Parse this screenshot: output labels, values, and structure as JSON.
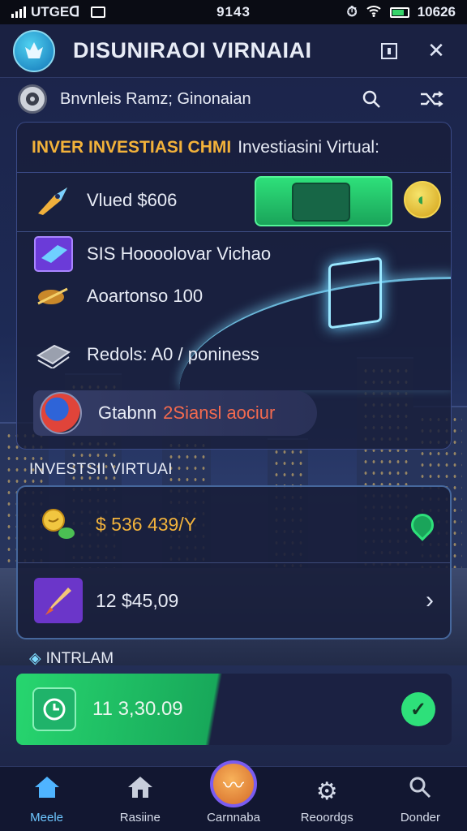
{
  "status_bar": {
    "carrier": "UTGEᗡ",
    "time": "9143",
    "right_text": "10626",
    "battery_level": 0.8
  },
  "header": {
    "title": "DISUNIRAOI VIRNAIAI",
    "icons": {
      "logo": "app-logo",
      "menu": "square-menu-icon",
      "close": "close-icon"
    }
  },
  "sub_header": {
    "label": "Bnvnleis Ramz; Ginonaian",
    "icons": [
      "settings-avatar",
      "search-refresh-icon",
      "shuffle-icon"
    ]
  },
  "invest_card": {
    "heading_accent": "INVER INVESTIASI CHMI",
    "heading_rest": "Investiasini Virtual:",
    "rows": [
      {
        "label": "Vlued $606",
        "icon": "rocket-icon"
      },
      {
        "label": "SIS Hoooolovar Vichao",
        "icon": "crystal-icon"
      },
      {
        "label": "Aoartonso 100",
        "icon": "satellite-icon"
      },
      {
        "label": "Redols: A0 / poniness",
        "icon": "cash-icon"
      }
    ],
    "toggle_on": true,
    "action": {
      "prefix": "Gtabnn",
      "highlight": "2Siansl aociur"
    }
  },
  "portfolio": {
    "section_label": "INVESTSII VIRTUAI",
    "rows": [
      {
        "value": "$ 536 439/Y",
        "icon": "coins-icon",
        "trailing": "pin-icon"
      },
      {
        "value": "12 $45,09",
        "icon": "rocket-launch-icon",
        "trailing": "chevron-right-icon"
      }
    ]
  },
  "intram": {
    "label": "INTRLAM",
    "value": "11 3,30.09"
  },
  "bottom_nav": [
    {
      "label": "Meele",
      "icon": "home-icon",
      "active": true
    },
    {
      "label": "Rasiine",
      "icon": "house-icon",
      "active": false
    },
    {
      "label": "Carnnaba",
      "icon": "center-action-icon",
      "active": false
    },
    {
      "label": "Reoordgs",
      "icon": "gear-icon",
      "active": false
    },
    {
      "label": "Donder",
      "icon": "search-icon",
      "active": false
    }
  ]
}
